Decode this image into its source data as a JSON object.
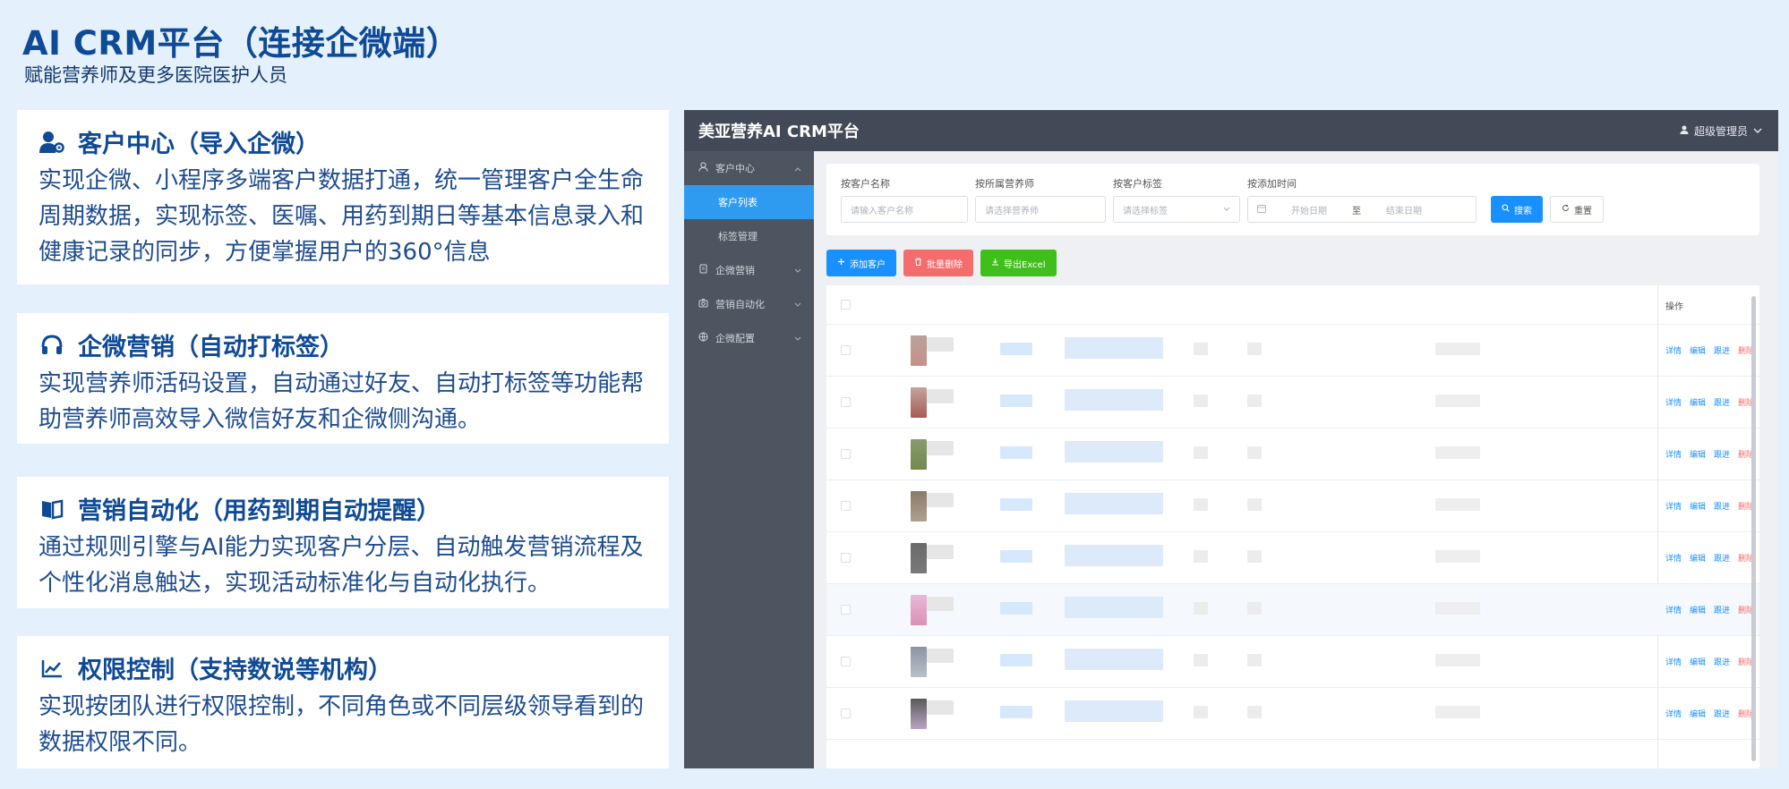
{
  "page": {
    "title": "AI CRM平台（连接企微端）",
    "subtitle": "赋能营养师及更多医院医护人员"
  },
  "features": [
    {
      "icon": "user-gear-icon",
      "title": "客户中心（导入企微）",
      "desc": "实现企微、小程序多端客户数据打通，统一管理客户全生命周期数据，实现标签、医嘱、用药到期日等基本信息录入和健康记录的同步，方便掌握用户的360°信息"
    },
    {
      "icon": "headset-icon",
      "title": "企微营销（自动打标签）",
      "desc": "实现营养师活码设置，自动通过好友、自动打标签等功能帮助营养师高效导入微信好友和企微侧沟通。"
    },
    {
      "icon": "book-icon",
      "title": "营销自动化（用药到期自动提醒）",
      "desc": "通过规则引擎与AI能力实现客户分层、自动触发营销流程及个性化消息触达，实现活动标准化与自动化执行。"
    },
    {
      "icon": "chart-line-icon",
      "title": "权限控制（支持数说等机构）",
      "desc": "实现按团队进行权限控制，不同角色或不同层级领导看到的数据权限不同。"
    }
  ],
  "app": {
    "title": "美亚营养AI CRM平台",
    "user": "超级管理员",
    "sidebar": [
      {
        "label": "客户中心",
        "icon": "user-icon",
        "type": "group"
      },
      {
        "label": "客户列表",
        "type": "sub",
        "active": true
      },
      {
        "label": "标签管理",
        "type": "sub"
      },
      {
        "label": "企微营销",
        "icon": "document-icon",
        "type": "group"
      },
      {
        "label": "营销自动化",
        "icon": "camera-icon",
        "type": "group"
      },
      {
        "label": "企微配置",
        "icon": "globe-icon",
        "type": "group"
      }
    ],
    "filters": {
      "name_label": "按客户名称",
      "name_placeholder": "请输入客户名称",
      "nutritionist_label": "按所属营养师",
      "nutritionist_placeholder": "请选择营养师",
      "tag_label": "按客户标签",
      "tag_placeholder": "请选择标签",
      "time_label": "按添加时间",
      "start_placeholder": "开始日期",
      "range_sep": "至",
      "end_placeholder": "结束日期",
      "search_label": "搜索",
      "reset_label": "重置"
    },
    "actions": {
      "add_label": "添加客户",
      "batch_delete_label": "批量删除",
      "export_label": "导出Excel"
    },
    "table": {
      "op_header": "操作",
      "row_actions": [
        "详情",
        "编辑",
        "跟进",
        "删除"
      ],
      "rows": 8
    },
    "colors": {
      "header": "#414a56",
      "sidebar": "#4d5560",
      "accent": "#1890ff",
      "danger": "#f56c6c",
      "success": "#3fbf1a",
      "brand_blue": "#0f4a96"
    }
  }
}
